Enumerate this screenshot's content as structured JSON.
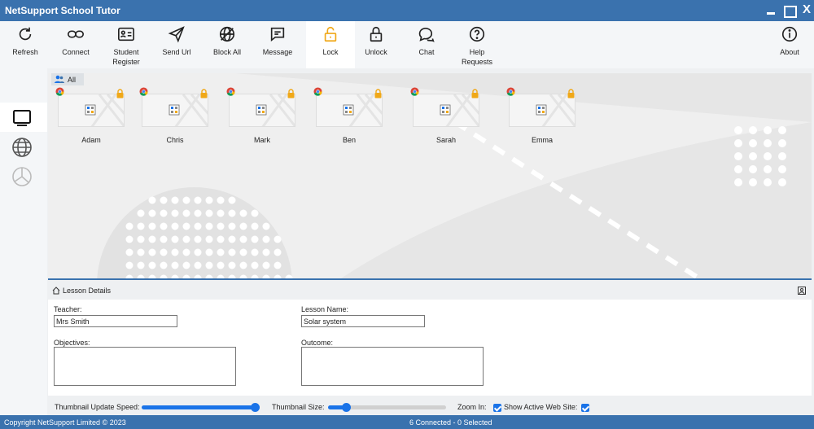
{
  "window": {
    "title": "NetSupport School Tutor"
  },
  "toolbar": {
    "refresh": "Refresh",
    "connect": "Connect",
    "student_register_1": "Student",
    "student_register_2": "Register",
    "send_url": "Send Url",
    "block_all": "Block All",
    "message": "Message",
    "lock": "Lock",
    "unlock": "Unlock",
    "chat": "Chat",
    "help_requests_1": "Help",
    "help_requests_2": "Requests",
    "about": "About"
  },
  "view": {
    "group_tab": "All",
    "students": [
      {
        "name": "Adam",
        "locked": true
      },
      {
        "name": "Chris",
        "locked": true
      },
      {
        "name": "Mark",
        "locked": true
      },
      {
        "name": "Ben",
        "locked": true
      },
      {
        "name": "Sarah",
        "locked": true
      },
      {
        "name": "Emma",
        "locked": true
      }
    ]
  },
  "lesson": {
    "header": "Lesson Details",
    "teacher_label": "Teacher:",
    "teacher_value": "Mrs Smith",
    "lesson_name_label": "Lesson Name:",
    "lesson_name_value": "Solar system",
    "objectives_label": "Objectives:",
    "outcome_label": "Outcome:"
  },
  "controls": {
    "thumb_update_label": "Thumbnail Update Speed:",
    "thumb_update_value": 1.0,
    "thumb_size_label": "Thumbnail Size:",
    "thumb_size_value": 0.13,
    "zoom_in_label": "Zoom In:",
    "zoom_in_checked": true,
    "show_web_label": "Show Active Web Site:",
    "show_web_checked": true
  },
  "status": {
    "copyright": "Copyright NetSupport Limited © 2023",
    "summary": "6 Connected - 0 Selected"
  },
  "colors": {
    "accent": "#3a72ae",
    "lock_icon": "#f0a818",
    "slider": "#1a73e8"
  }
}
